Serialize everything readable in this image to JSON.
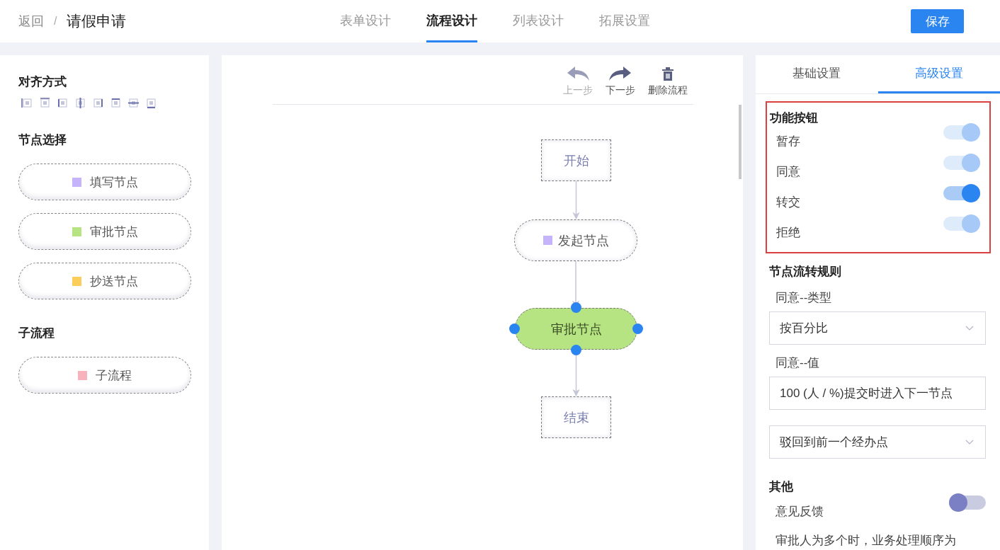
{
  "header": {
    "back": "返回",
    "separator": "/",
    "title": "请假申请",
    "tabs": [
      {
        "label": "表单设计",
        "selected": false
      },
      {
        "label": "流程设计",
        "selected": true
      },
      {
        "label": "列表设计",
        "selected": false
      },
      {
        "label": "拓展设置",
        "selected": false
      }
    ],
    "save": "保存"
  },
  "left_panel": {
    "align_title": "对齐方式",
    "sections": [
      {
        "title": "节点选择",
        "items": [
          {
            "label": "填写节点",
            "color": "#c5b3fb"
          },
          {
            "label": "审批节点",
            "color": "#b6e483"
          },
          {
            "label": "抄送节点",
            "color": "#fbcd5a"
          }
        ]
      },
      {
        "title": "子流程",
        "items": [
          {
            "label": "子流程",
            "color": "#f7b2bb"
          }
        ]
      }
    ]
  },
  "toolbar": [
    {
      "kind": "undo",
      "label": "上一步",
      "disabled": true
    },
    {
      "kind": "redo",
      "label": "下一步",
      "disabled": false
    },
    {
      "kind": "delete",
      "label": "删除流程",
      "disabled": false
    }
  ],
  "diagram": {
    "nodes": [
      {
        "kind": "rect",
        "label": "开始",
        "selected": false
      },
      {
        "kind": "pill",
        "label": "发起节点",
        "color": "#c5b3fb",
        "selected": false
      },
      {
        "kind": "pill",
        "label": "审批节点",
        "selected": true
      },
      {
        "kind": "rect",
        "label": "结束",
        "selected": false
      }
    ]
  },
  "right_panel": {
    "tabs": [
      {
        "label": "基础设置",
        "selected": false
      },
      {
        "label": "高级设置",
        "selected": true
      }
    ],
    "function_buttons": {
      "title": "功能按钮",
      "toggles": [
        {
          "label": "暂存",
          "on": true,
          "disabled": true
        },
        {
          "label": "同意",
          "on": true,
          "disabled": true
        },
        {
          "label": "转交",
          "on": true,
          "disabled": false
        },
        {
          "label": "拒绝",
          "on": true,
          "disabled": true
        }
      ]
    },
    "flow_rules": {
      "title": "节点流转规则",
      "fields": [
        {
          "kind": "select",
          "label": "同意--类型",
          "value": "按百分比"
        },
        {
          "kind": "input",
          "label": "同意--值",
          "value": "100 (人 / %)提交时进入下一节点"
        },
        {
          "kind": "select",
          "value": "驳回到前一个经办点"
        }
      ]
    },
    "other": {
      "title": "其他",
      "toggles": [
        {
          "label": "意见反馈",
          "on": false,
          "disabled": false
        }
      ],
      "note": "审批人为多个时，业务处理顺序为"
    }
  }
}
